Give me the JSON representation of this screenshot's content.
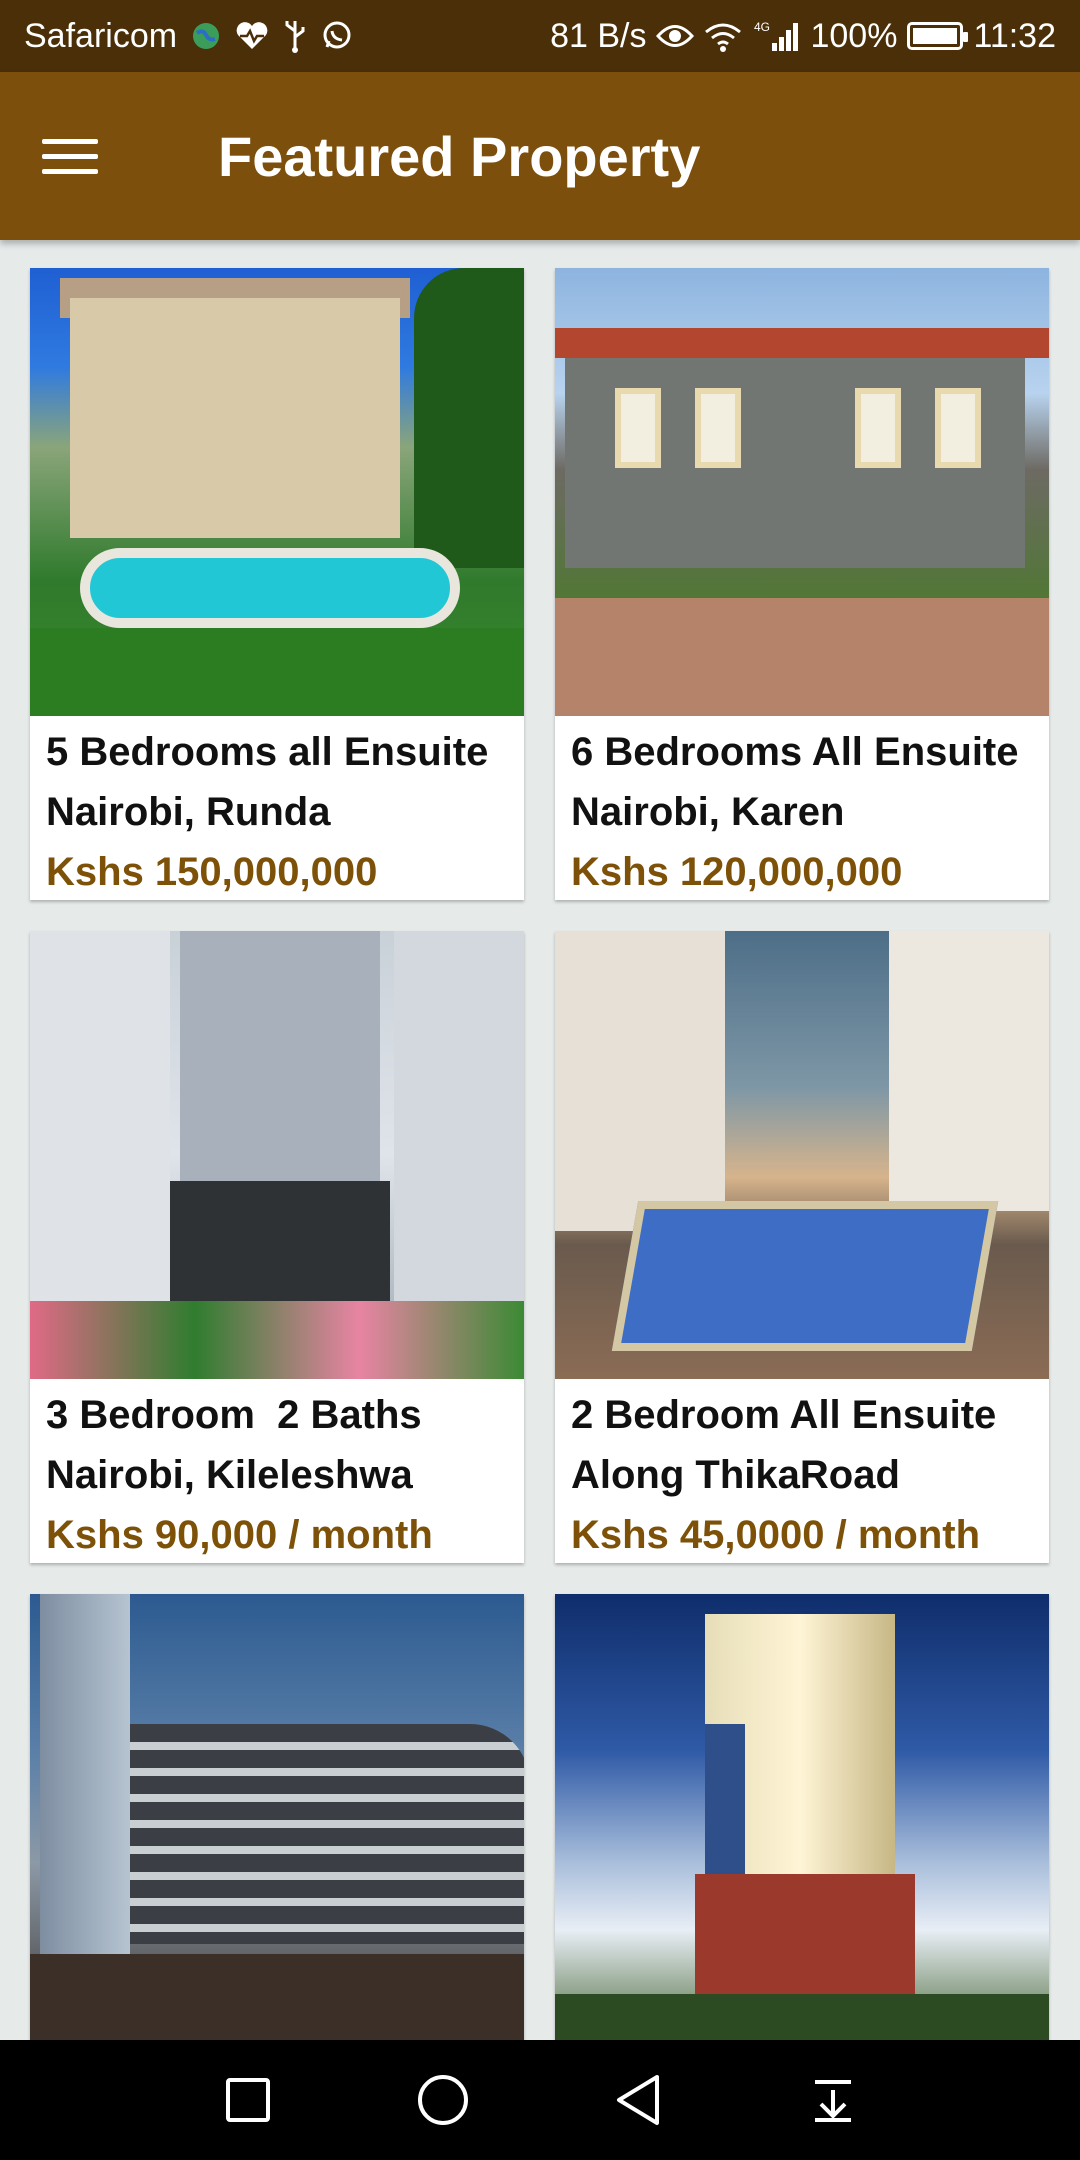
{
  "status_bar": {
    "carrier": "Safaricom",
    "network_speed": "81 B/s",
    "network_type": "4G",
    "battery": "100%",
    "time": "11:32",
    "icons": [
      "globe-icon",
      "heart-rate-icon",
      "usb-icon",
      "whatsapp-icon",
      "eye-icon",
      "wifi-icon",
      "signal-icon",
      "battery-icon"
    ]
  },
  "app_bar": {
    "title": "Featured Property",
    "menu_icon": "hamburger-menu-icon"
  },
  "properties": [
    {
      "title": "5 Bedrooms all Ensuite",
      "location": "Nairobi, Runda",
      "price": "Kshs 150,000,000",
      "image": "villa-with-pool"
    },
    {
      "title": "6 Bedrooms All Ensuite",
      "location": "Nairobi, Karen",
      "price": "Kshs 120,000,000",
      "image": "stone-house"
    },
    {
      "title": "3 Bedroom  2 Baths",
      "location": "Nairobi, Kileleshwa",
      "price": "Kshs 90,000 / month",
      "image": "apartment-blocks"
    },
    {
      "title": "2 Bedroom All Ensuite",
      "location": "Along ThikaRoad",
      "price": "Kshs 45,0000 / month",
      "image": "pool-complex-dusk"
    },
    {
      "title": "",
      "location": "",
      "price": "",
      "image": "curved-building"
    },
    {
      "title": "",
      "location": "",
      "price": "",
      "image": "tall-tower"
    }
  ],
  "nav_bar": {
    "buttons": [
      "recent-apps-icon",
      "home-icon",
      "back-icon",
      "notifications-down-icon"
    ]
  },
  "colors": {
    "status_bar": "#4a2f08",
    "app_bar": "#7d4f0c",
    "price": "#7d5208",
    "background": "#e6ebea"
  }
}
